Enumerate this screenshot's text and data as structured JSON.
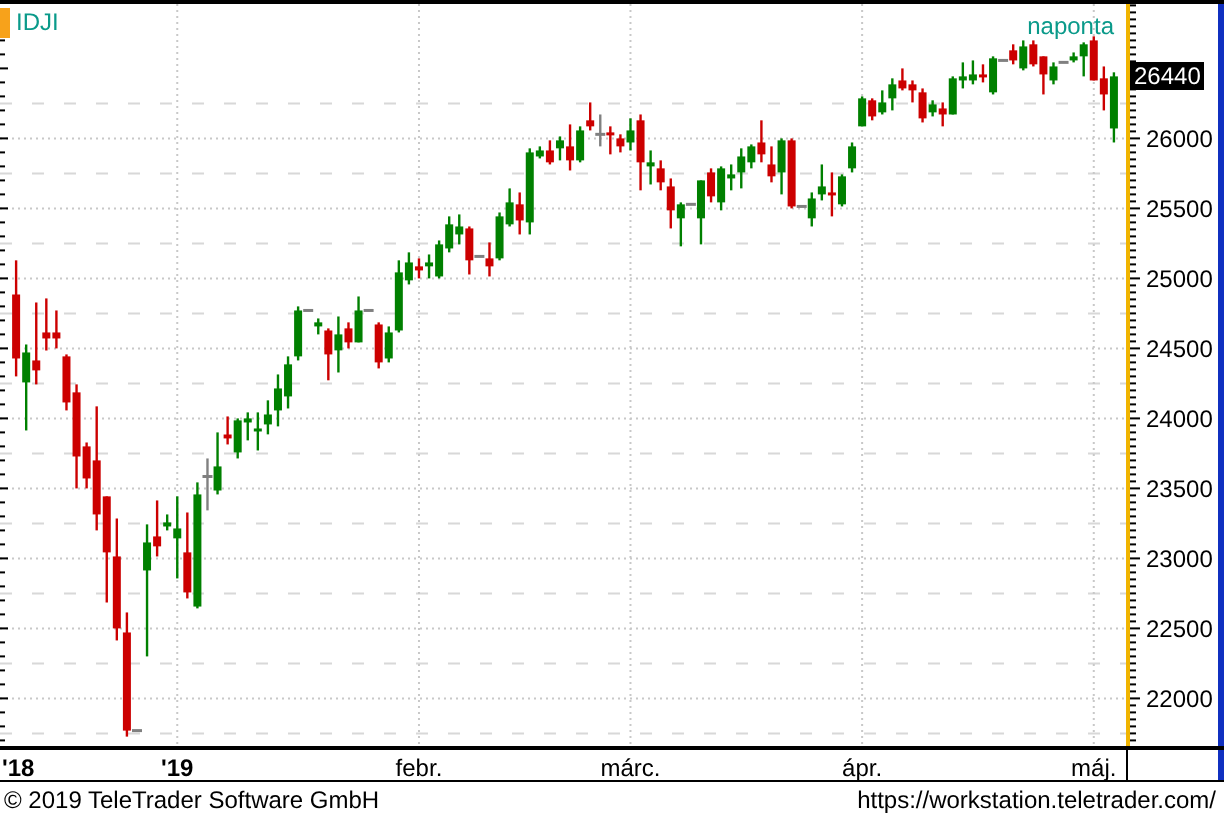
{
  "header": {
    "symbol": "IDJI",
    "period": "naponta"
  },
  "chart": {
    "last_price": "26440",
    "chart_data": {
      "type": "candlestick",
      "grid": true,
      "ylim": [
        21660,
        26960
      ],
      "yticks": [
        22000,
        22500,
        23000,
        23500,
        24000,
        24500,
        25000,
        25500,
        26000
      ],
      "categories": [
        "'18",
        null,
        null,
        null,
        null,
        null,
        null,
        null,
        null,
        null,
        null,
        null,
        null,
        null,
        null,
        null,
        "'19",
        null,
        null,
        null,
        null,
        null,
        null,
        null,
        null,
        null,
        null,
        null,
        null,
        null,
        null,
        null,
        null,
        null,
        null,
        null,
        null,
        null,
        null,
        null,
        "febr.",
        null,
        null,
        null,
        null,
        null,
        null,
        null,
        null,
        null,
        null,
        null,
        null,
        null,
        null,
        null,
        null,
        null,
        null,
        null,
        null,
        "márc.",
        null,
        null,
        null,
        null,
        null,
        null,
        null,
        null,
        null,
        null,
        null,
        null,
        null,
        null,
        null,
        null,
        null,
        null,
        null,
        null,
        null,
        null,
        "ápr.",
        null,
        null,
        null,
        null,
        null,
        null,
        null,
        null,
        null,
        null,
        null,
        null,
        null,
        null,
        null,
        null,
        null,
        null,
        null,
        null,
        null,
        null,
        "máj.",
        null,
        null
      ],
      "ohlc": [
        [
          24885,
          25129,
          24300,
          24428
        ],
        [
          24257,
          24528,
          23914,
          24471
        ],
        [
          24414,
          24828,
          24243,
          24343
        ],
        [
          24614,
          24857,
          24485,
          24571
        ],
        [
          24614,
          24771,
          24500,
          24571
        ],
        [
          24443,
          24457,
          24057,
          24114
        ],
        [
          24186,
          24243,
          23500,
          23728
        ],
        [
          23800,
          23828,
          23500,
          23571
        ],
        [
          23700,
          24086,
          23200,
          23314
        ],
        [
          23443,
          23443,
          22685,
          23043
        ],
        [
          23014,
          23285,
          22414,
          22500
        ],
        [
          22471,
          22614,
          21727,
          21770
        ],
        [
          21770,
          21770,
          21770,
          21770
        ],
        [
          22914,
          23243,
          22300,
          23114
        ],
        [
          23157,
          23414,
          23014,
          23086
        ],
        [
          23228,
          23314,
          23200,
          23257
        ],
        [
          23143,
          23443,
          22857,
          23214
        ],
        [
          23043,
          23328,
          22714,
          22757
        ],
        [
          22656,
          23543,
          22643,
          23457
        ],
        [
          23585,
          23714,
          23343,
          23585
        ],
        [
          23485,
          23900,
          23457,
          23657
        ],
        [
          23885,
          24014,
          23814,
          23857
        ],
        [
          23757,
          24000,
          23714,
          23986
        ],
        [
          23971,
          24043,
          23843,
          24000
        ],
        [
          23914,
          24043,
          23771,
          23928
        ],
        [
          23957,
          24129,
          23886,
          24028
        ],
        [
          24057,
          24314,
          23943,
          24214
        ],
        [
          24157,
          24443,
          24071,
          24386
        ],
        [
          24443,
          24800,
          24414,
          24771
        ],
        [
          24771,
          24771,
          24771,
          24771
        ],
        [
          24657,
          24714,
          24600,
          24686
        ],
        [
          24628,
          24643,
          24272,
          24457
        ],
        [
          24486,
          24728,
          24328,
          24600
        ],
        [
          24643,
          24686,
          24500,
          24543
        ],
        [
          24543,
          24871,
          24543,
          24771
        ],
        [
          24771,
          24771,
          24771,
          24771
        ],
        [
          24671,
          24686,
          24357,
          24400
        ],
        [
          24428,
          24657,
          24400,
          24614
        ],
        [
          24628,
          25129,
          24614,
          25043
        ],
        [
          24986,
          25186,
          24957,
          25114
        ],
        [
          25086,
          25143,
          25000,
          25057
        ],
        [
          25086,
          25171,
          25000,
          25114
        ],
        [
          25014,
          25271,
          25000,
          25243
        ],
        [
          25214,
          25443,
          25186,
          25386
        ],
        [
          25314,
          25457,
          25243,
          25371
        ],
        [
          25357,
          25371,
          25028,
          25129
        ],
        [
          25157,
          25157,
          25157,
          25157
        ],
        [
          25143,
          25257,
          25014,
          25086
        ],
        [
          25143,
          25471,
          25129,
          25443
        ],
        [
          25386,
          25643,
          25371,
          25543
        ],
        [
          25529,
          25614,
          25314,
          25414
        ],
        [
          25400,
          25929,
          25314,
          25900
        ],
        [
          25871,
          25943,
          25857,
          25914
        ],
        [
          25914,
          25986,
          25814,
          25829
        ],
        [
          25929,
          26014,
          25843,
          25986
        ],
        [
          25943,
          26100,
          25771,
          25843
        ],
        [
          25843,
          26086,
          25829,
          26057
        ],
        [
          26129,
          26257,
          26057,
          26086
        ],
        [
          26029,
          26171,
          25943,
          26029
        ],
        [
          26043,
          26086,
          25886,
          26029
        ],
        [
          26000,
          26029,
          25900,
          25943
        ],
        [
          25971,
          26143,
          25914,
          26057
        ],
        [
          26129,
          26171,
          25629,
          25829
        ],
        [
          25800,
          25914,
          25671,
          25829
        ],
        [
          25786,
          25843,
          25629,
          25686
        ],
        [
          25657,
          25714,
          25357,
          25486
        ],
        [
          25429,
          25543,
          25229,
          25529
        ],
        [
          25529,
          25529,
          25529,
          25529
        ],
        [
          25429,
          25700,
          25243,
          25700
        ],
        [
          25757,
          25786,
          25543,
          25586
        ],
        [
          25543,
          25800,
          25486,
          25786
        ],
        [
          25714,
          25814,
          25629,
          25743
        ],
        [
          25757,
          25929,
          25643,
          25871
        ],
        [
          25829,
          25957,
          25786,
          25943
        ],
        [
          25971,
          26129,
          25829,
          25886
        ],
        [
          25814,
          25943,
          25686,
          25729
        ],
        [
          25757,
          26000,
          25600,
          25986
        ],
        [
          25986,
          26000,
          25500,
          25514
        ],
        [
          25514,
          25514,
          25514,
          25514
        ],
        [
          25429,
          25614,
          25371,
          25571
        ],
        [
          25600,
          25814,
          25557,
          25657
        ],
        [
          25614,
          25757,
          25443,
          25600
        ],
        [
          25529,
          25743,
          25514,
          25729
        ],
        [
          25786,
          25971,
          25757,
          25943
        ],
        [
          26086,
          26300,
          26086,
          26286
        ],
        [
          26272,
          26286,
          26129,
          26157
        ],
        [
          26186,
          26343,
          26171,
          26257
        ],
        [
          26286,
          26429,
          26200,
          26386
        ],
        [
          26414,
          26500,
          26343,
          26357
        ],
        [
          26386,
          26414,
          26257,
          26343
        ],
        [
          26329,
          26357,
          26114,
          26143
        ],
        [
          26186,
          26272,
          26157,
          26243
        ],
        [
          26214,
          26257,
          26086,
          26171
        ],
        [
          26171,
          26443,
          26171,
          26429
        ],
        [
          26414,
          26543,
          26357,
          26443
        ],
        [
          26414,
          26557,
          26386,
          26457
        ],
        [
          26457,
          26529,
          26400,
          26443
        ],
        [
          26329,
          26586,
          26314,
          26572
        ],
        [
          26557,
          26557,
          26557,
          26557
        ],
        [
          26629,
          26672,
          26529,
          26557
        ],
        [
          26500,
          26700,
          26486,
          26657
        ],
        [
          26672,
          26700,
          26514,
          26529
        ],
        [
          26586,
          26586,
          26314,
          26457
        ],
        [
          26414,
          26543,
          26386,
          26514
        ],
        [
          26543,
          26543,
          26543,
          26543
        ],
        [
          26557,
          26614,
          26543,
          26586
        ],
        [
          26586,
          26686,
          26443,
          26672
        ],
        [
          26700,
          26729,
          26414,
          26414
        ],
        [
          26429,
          26514,
          26200,
          26314
        ],
        [
          26071,
          26472,
          25971,
          26443
        ]
      ]
    }
  },
  "footer": {
    "copyright": "© 2019 TeleTrader Software GmbH",
    "url": "https://workstation.teletrader.com/"
  }
}
